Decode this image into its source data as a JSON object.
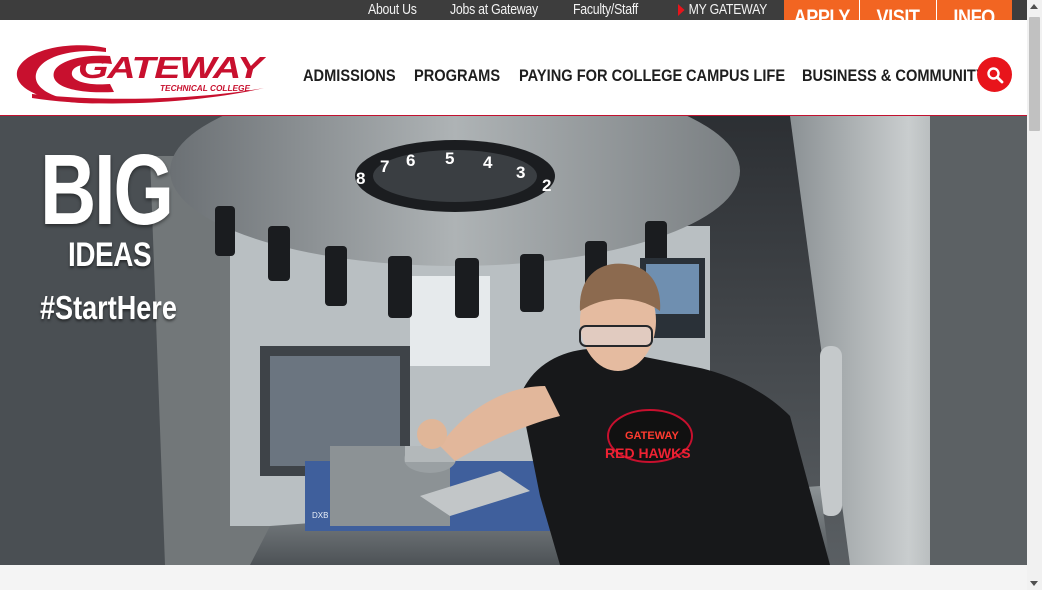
{
  "utility_nav": {
    "links": [
      "About Us",
      "Jobs at Gateway",
      "Faculty/Staff"
    ],
    "my_gateway": "MY GATEWAY"
  },
  "cta": {
    "apply": "APPLY",
    "visit": "VISIT",
    "info": "INFO"
  },
  "logo": {
    "name": "GATEWAY",
    "tagline": "TECHNICAL COLLEGE"
  },
  "main_nav": {
    "items": [
      "ADMISSIONS",
      "PROGRAMS",
      "PAYING FOR COLLEGE",
      "CAMPUS LIFE",
      "BUSINESS & COMMUNITY"
    ]
  },
  "hero": {
    "headline": "BIG",
    "subheadline": "IDEAS",
    "hashtag": "#StartHere",
    "tool_numbers": [
      "8",
      "7",
      "6",
      "5",
      "4",
      "3",
      "2"
    ],
    "shirt_brand": "GATEWAY",
    "shirt_text": "RED HAWKS",
    "vise_label": "DXB CrossOver"
  },
  "colors": {
    "brand_red": "#e8141b",
    "cta_orange": "#f26522",
    "utility_bar": "#3d3d3d",
    "nav_text": "#1e1e1e"
  }
}
